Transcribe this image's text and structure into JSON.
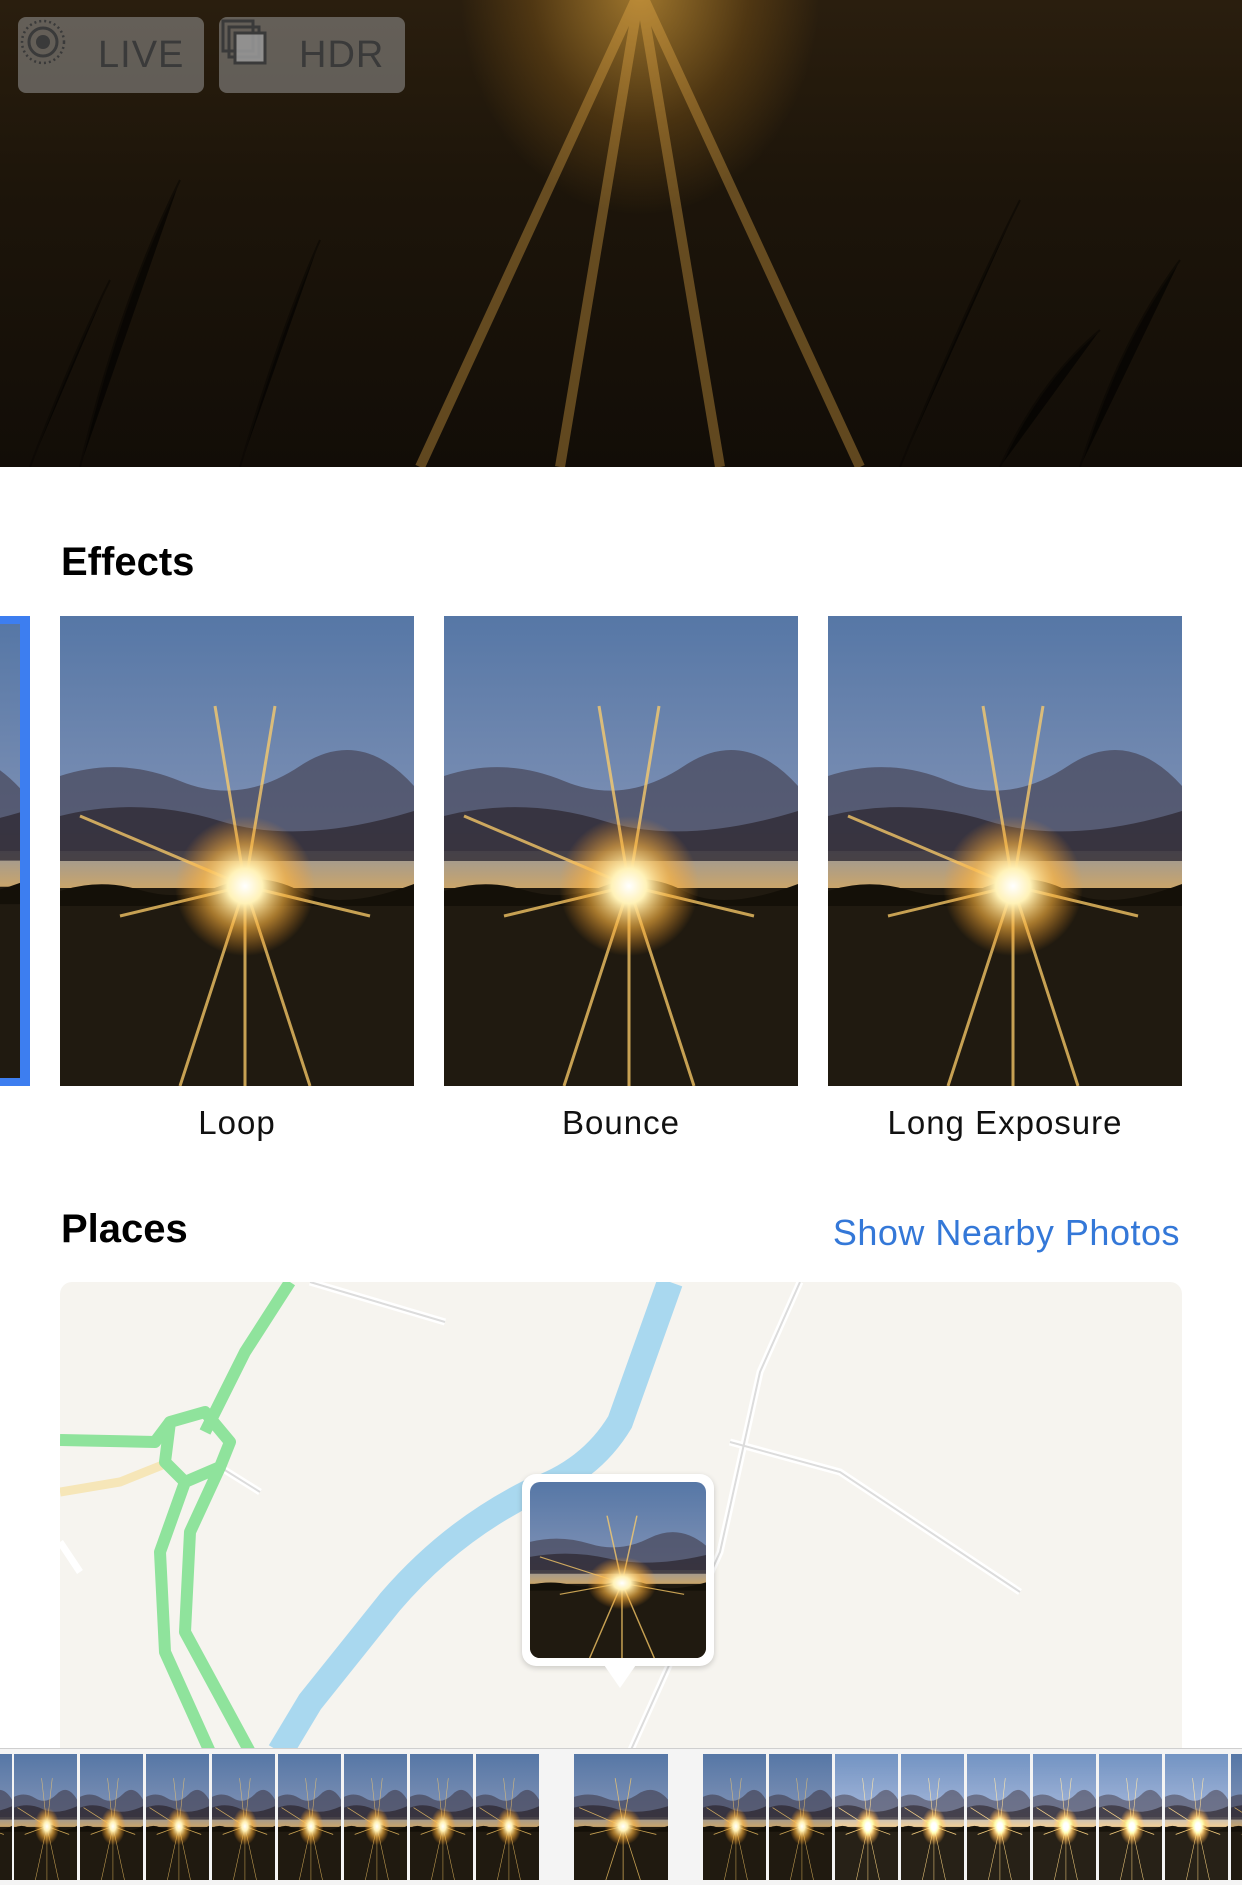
{
  "badges": {
    "live": {
      "label": "LIVE",
      "icon": "live-photo-icon"
    },
    "hdr": {
      "label": "HDR",
      "icon": "hdr-icon"
    }
  },
  "effects": {
    "title": "Effects",
    "items": [
      {
        "label": "Loop"
      },
      {
        "label": "Bounce"
      },
      {
        "label": "Long Exposure"
      }
    ]
  },
  "places": {
    "title": "Places",
    "link": "Show Nearby Photos"
  },
  "colors": {
    "accent": "#3478d8",
    "selection": "#3d7ef0",
    "road_green": "#8fe39c",
    "river": "#a9d8ef",
    "map_bg": "#f6f4ef"
  },
  "filmstrip": {
    "thumbnail_count": 18
  }
}
